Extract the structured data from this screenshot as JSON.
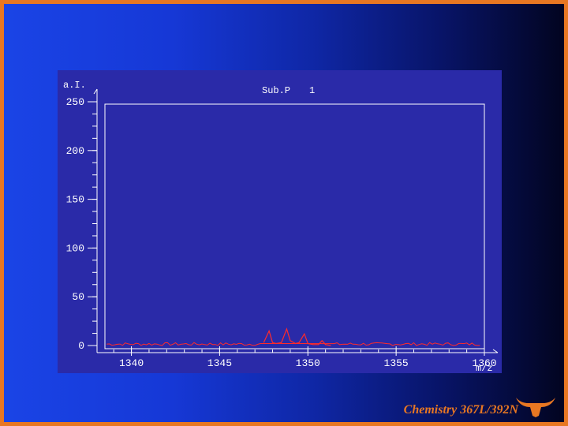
{
  "slide": {
    "footer": "Chemistry 367L/392N",
    "logo_icon": "longhorn-icon",
    "colors": {
      "border": "#e87722",
      "gradient_start": "#1a44e6",
      "gradient_end": "#020420"
    }
  },
  "chart_data": {
    "type": "line",
    "header": "Sub.P",
    "header_value": "1",
    "ylabel": "a.I.",
    "xlabel": "m/z",
    "xlim": [
      1338.5,
      1360
    ],
    "ylim": [
      0,
      250
    ],
    "x_ticks": [
      1340,
      1345,
      1350,
      1355,
      1360
    ],
    "y_ticks": [
      0,
      50,
      100,
      150,
      200,
      250
    ],
    "grid": false,
    "line_color": "#ff2a2a",
    "series": [
      {
        "x": [
          1347.5,
          1347.8,
          1348.0,
          1348.2,
          1348.5,
          1348.8,
          1349.0,
          1349.3,
          1349.5,
          1349.8,
          1350.0,
          1350.3,
          1350.6,
          1350.8,
          1351.0,
          1351.3
        ],
        "values": [
          3,
          15,
          3,
          2,
          3,
          17,
          5,
          2,
          3,
          12,
          2,
          1,
          1,
          5,
          1,
          0
        ]
      }
    ]
  }
}
